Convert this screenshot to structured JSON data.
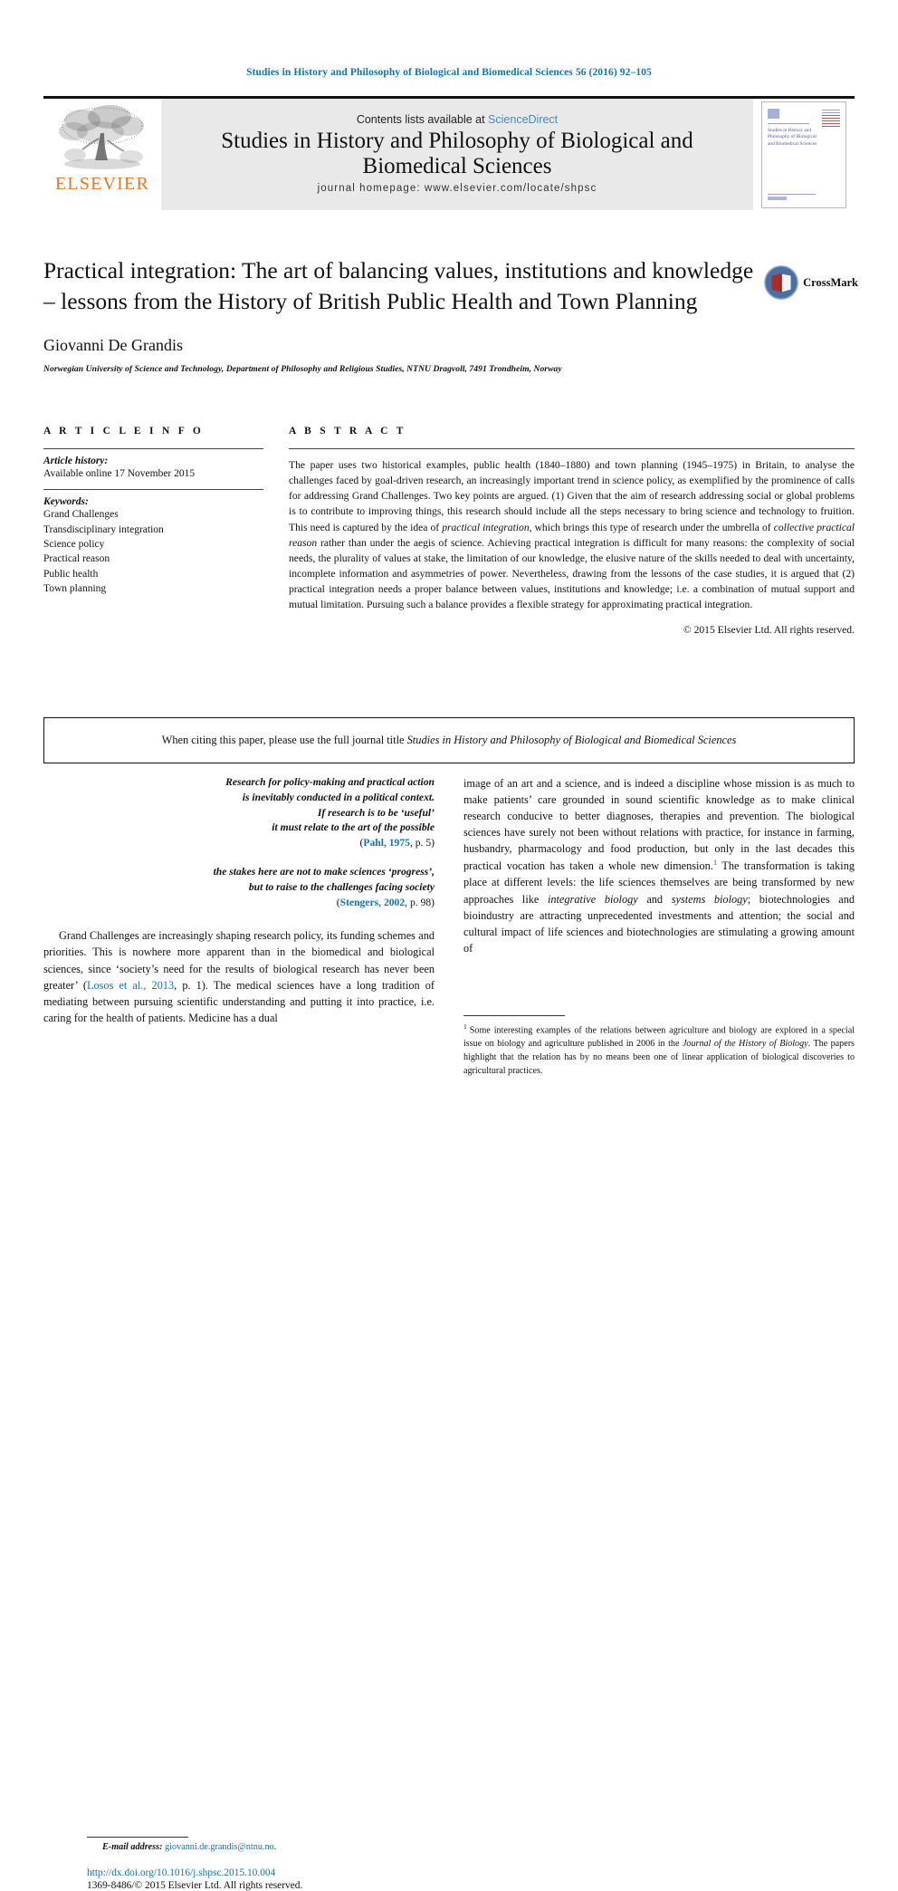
{
  "running_head": "Studies in History and Philosophy of Biological and Biomedical Sciences 56 (2016) 92–105",
  "masthead": {
    "publisher_name": "ELSEVIER",
    "contents_prefix": "Contents lists available at ",
    "contents_link": "ScienceDirect",
    "journal_title": "Studies in History and Philosophy of Biological and Biomedical Sciences",
    "homepage": "journal homepage: www.elsevier.com/locate/shpsc",
    "cover_title": "Studies in History and Philosophy of Biological and Biomedical Sciences"
  },
  "article": {
    "title": "Practical integration: The art of balancing values, institutions and knowledge – lessons from the History of British Public Health and Town Planning",
    "author": "Giovanni De Grandis",
    "affiliation": "Norwegian University of Science and Technology, Department of Philosophy and Religious Studies, NTNU Dragvoll, 7491 Trondheim, Norway",
    "crossmark_label": "CrossMark"
  },
  "article_info": {
    "heading": "A R T I C L E   I N F O",
    "history_label": "Article history:",
    "history_value": "Available online 17 November 2015",
    "keywords_label": "Keywords:",
    "keywords": [
      "Grand Challenges",
      "Transdisciplinary integration",
      "Science policy",
      "Practical reason",
      "Public health",
      "Town planning"
    ]
  },
  "abstract": {
    "heading": "A B S T R A C T",
    "part1": "The paper uses two historical examples, public health (1840–1880) and town planning (1945–1975) in Britain, to analyse the challenges faced by goal-driven research, an increasingly important trend in science policy, as exemplified by the prominence of calls for addressing Grand Challenges. Two key points are argued. (1) Given that the aim of research addressing social or global problems is to contribute to improving things, this research should include all the steps necessary to bring science and technology to fruition. This need is captured by the idea of ",
    "italic1": "practical integration",
    "part2": ", which brings this type of research under the umbrella of ",
    "italic2": "collective practical reason",
    "part3": " rather than under the aegis of science. Achieving practical integration is difficult for many reasons: the complexity of social needs, the plurality of values at stake, the limitation of our knowledge, the elusive nature of the skills needed to deal with uncertainty, incomplete information and asymmetries of power. Nevertheless, drawing from the lessons of the case studies, it is argued that (2) practical integration needs a proper balance between values, institutions and knowledge; i.e. a combination of mutual support and mutual limitation. Pursuing such a balance provides a flexible strategy for approximating practical integration.",
    "copyright": "© 2015 Elsevier Ltd. All rights reserved."
  },
  "citing_notice": {
    "prefix": "When citing this paper, please use the full journal title ",
    "journal": "Studies in History and Philosophy of Biological and Biomedical Sciences"
  },
  "epigraphs": [
    {
      "lines": [
        "Research for policy-making and practical action",
        "is inevitably conducted in a political context.",
        "If research is to be ‘useful’",
        "it must relate to the art of the possible"
      ],
      "citation_link": "Pahl, 1975",
      "citation_rest": ", p. 5"
    },
    {
      "lines": [
        "the stakes here are not to make sciences ‘progress’,",
        "but to raise to the challenges facing society"
      ],
      "citation_link": "Stengers, 2002",
      "citation_rest": ", p. 98"
    }
  ],
  "body": {
    "left_para_a": "Grand Challenges are increasingly shaping research policy, its funding schemes and priorities. This is nowhere more apparent than in the biomedical and biological sciences, since ‘society’s need for the results of biological research has never been greater’ (",
    "left_link": "Losos et al., 2013",
    "left_para_b": ", p. 1). The medical sciences have a long tradition of mediating between pursuing scientific understanding and putting it into practice, i.e. caring for the health of patients. Medicine has a dual",
    "right_para_a": "image of an art and a science, and is indeed a discipline whose mission is as much to make patients’ care grounded in sound scientific knowledge as to make clinical research conducive to better diagnoses, therapies and prevention. The biological sciences have surely not been without relations with practice, for instance in farming, husbandry, pharmacology and food production, but only in the last decades this practical vocation has taken a whole new dimension.",
    "right_fn_marker": "1",
    "right_para_b": " The transformation is taking place at different levels: the life sciences themselves are being transformed by new approaches like ",
    "right_italic1": "integrative biology",
    "right_para_c": " and ",
    "right_italic2": "systems biology",
    "right_para_d": "; biotechnologies and bioindustry are attracting unprecedented investments and attention; the social and cultural impact of life sciences and biotechnologies are stimulating a growing amount of"
  },
  "footnote": {
    "marker": "1",
    "text_a": "Some interesting examples of the relations between agriculture and biology are explored in a special issue on biology and agriculture published in 2006 in the ",
    "journal": "Journal of the History of Biology",
    "text_b": ". The papers highlight that the relation has by no means been one of linear application of biological discoveries to agricultural practices."
  },
  "footer": {
    "email_label": "E-mail address:",
    "email": "giovanni.de.grandis@ntnu.no",
    "email_suffix": ".",
    "doi": "http://dx.doi.org/10.1016/j.shpsc.2015.10.004",
    "issn_line": "1369-8486/© 2015 Elsevier Ltd. All rights reserved."
  },
  "colors": {
    "link_blue": "#1274a8",
    "elsevier_orange": "#E87722",
    "sciencedirect_blue": "#3a8fc4",
    "masthead_gray": "#e9e9e9"
  }
}
